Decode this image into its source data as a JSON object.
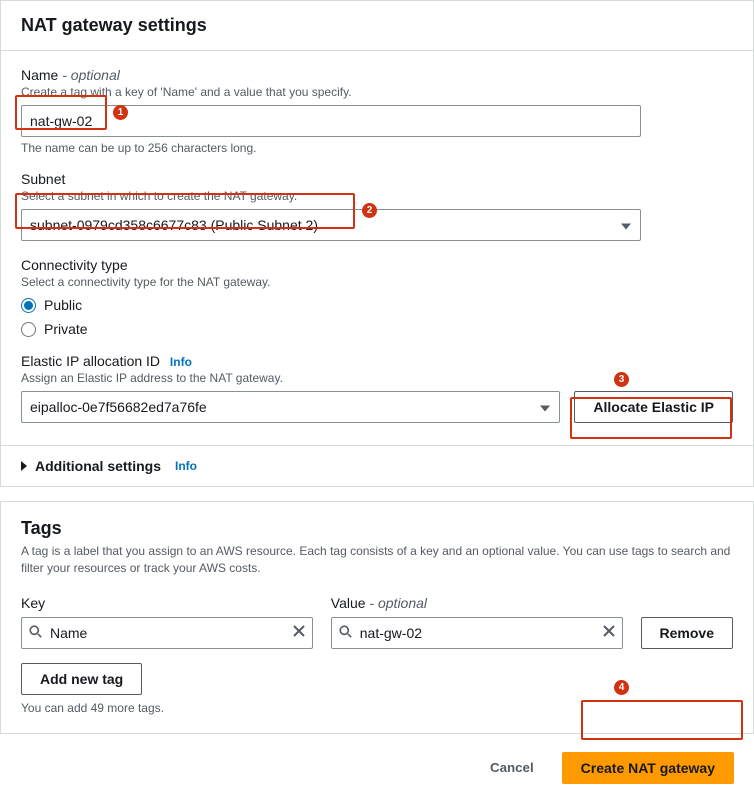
{
  "settings": {
    "title": "NAT gateway settings",
    "name": {
      "label": "Name",
      "optional": " - optional",
      "help": "Create a tag with a key of 'Name' and a value that you specify.",
      "value": "nat-gw-02",
      "hint": "The name can be up to 256 characters long."
    },
    "subnet": {
      "label": "Subnet",
      "help": "Select a subnet in which to create the NAT gateway.",
      "value": "subnet-0979cd358c6677c83 (Public Subnet 2)"
    },
    "connectivity": {
      "label": "Connectivity type",
      "help": "Select a connectivity type for the NAT gateway.",
      "options": {
        "public": "Public",
        "private": "Private"
      }
    },
    "eip": {
      "label": "Elastic IP allocation ID",
      "info": "Info",
      "help": "Assign an Elastic IP address to the NAT gateway.",
      "value": "eipalloc-0e7f56682ed7a76fe",
      "allocate_btn": "Allocate Elastic IP"
    },
    "additional": {
      "label": "Additional settings",
      "info": "Info"
    }
  },
  "tags": {
    "title": "Tags",
    "desc": "A tag is a label that you assign to an AWS resource. Each tag consists of a key and an optional value. You can use tags to search and filter your resources or track your AWS costs.",
    "key_label": "Key",
    "value_label": "Value",
    "value_optional": " - optional",
    "key_value": "Name",
    "val_value": "nat-gw-02",
    "remove": "Remove",
    "add": "Add new tag",
    "hint": "You can add 49 more tags."
  },
  "footer": {
    "cancel": "Cancel",
    "create": "Create NAT gateway"
  },
  "callouts": {
    "1": "1",
    "2": "2",
    "3": "3",
    "4": "4"
  }
}
